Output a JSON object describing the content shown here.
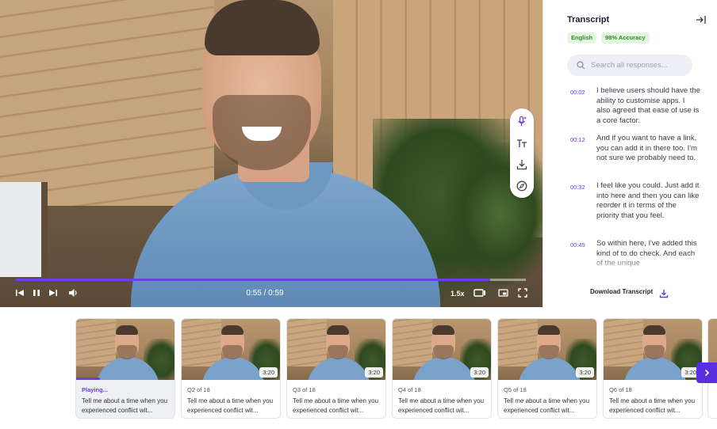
{
  "player": {
    "time_display": "0:55 / 0:59",
    "speed": "1.5x",
    "progress": 0.93
  },
  "tools": [
    "magic-mic-icon",
    "text-size-icon",
    "download-icon",
    "compass-icon"
  ],
  "transcript": {
    "title": "Transcript",
    "language": "English",
    "accuracy": "98% Accuracy",
    "search_placeholder": "Search all responses...",
    "entries": [
      {
        "time": "00:02",
        "text": "I believe users should have the ability to customise apps. I also agreed that ease of use is a core factor."
      },
      {
        "time": "00:12",
        "text": "And if you want to have a link, you can add it in there too. I'm not sure we probably need to."
      },
      {
        "time": "00:32",
        "text": "I feel like you could. Just add it into here and then you can like reorder it in terms of the priority that you feel."
      },
      {
        "time": "00:45",
        "text": "So within here, I've added this kind of to do check. And each of the unique"
      }
    ],
    "download_label": "Download Transcript"
  },
  "clips": [
    {
      "label": "Playing...",
      "duration": "",
      "text": "Tell me about a time when you experienced conflict wit...",
      "active": true
    },
    {
      "label": "Q2 of 18",
      "duration": "3:20",
      "text": "Tell me about a time when you experienced conflict wit..."
    },
    {
      "label": "Q3 of 18",
      "duration": "3:20",
      "text": "Tell me about a time when you experienced conflict wit..."
    },
    {
      "label": "Q4 of 18",
      "duration": "3:20",
      "text": "Tell me about a time when you experienced conflict wit..."
    },
    {
      "label": "Q5 of 18",
      "duration": "3:20",
      "text": "Tell me about a time when you experienced conflict wit..."
    },
    {
      "label": "Q6 of 18",
      "duration": "3:20",
      "text": "Tell me about a time when you experienced conflict wit..."
    }
  ],
  "colors": {
    "accent": "#6a3de8",
    "badge_bg": "#e3f7df",
    "badge_text": "#2e8a2a"
  }
}
